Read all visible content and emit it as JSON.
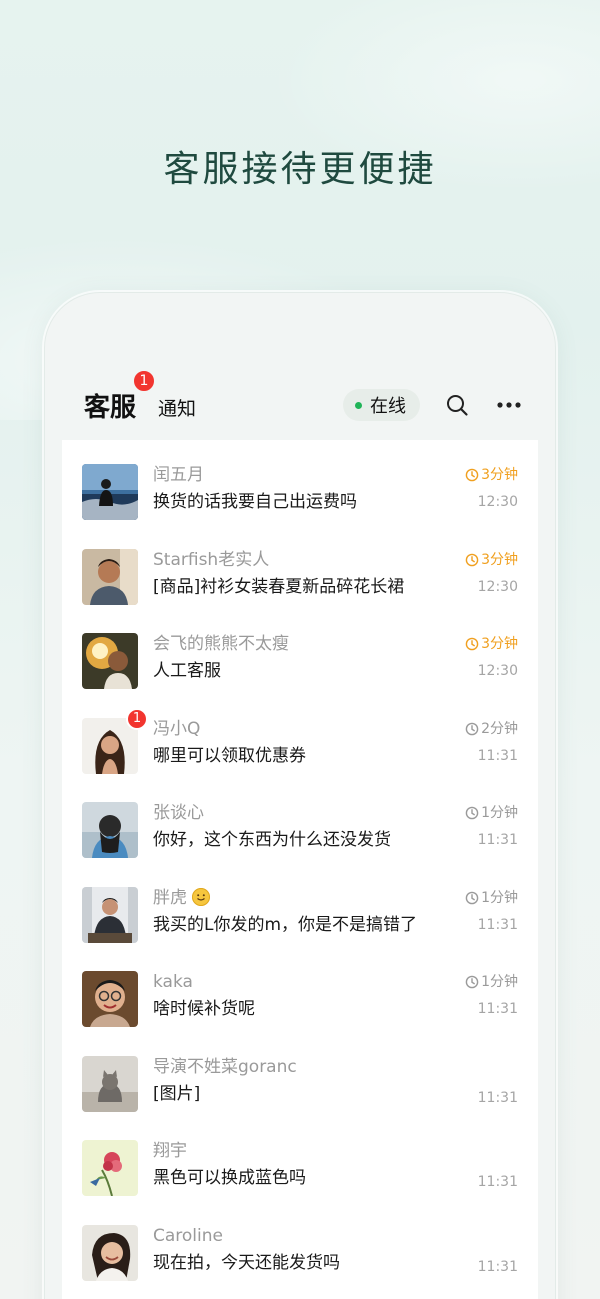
{
  "headline": "客服接待更便捷",
  "header": {
    "tab_service": "客服",
    "tab_service_badge": "1",
    "tab_notice": "通知",
    "status": "在线",
    "status_color": "#20b458"
  },
  "colors": {
    "warn": "#f0a020",
    "badge": "#f2352f"
  },
  "conversations": [
    {
      "name": "闰五月",
      "message": "换货的话我要自己出运费吗",
      "wait": "3分钟",
      "wait_level": "warn",
      "time": "12:30",
      "avatar": "seaside-person"
    },
    {
      "name": "Starfish老实人",
      "message": "[商品]衬衫女装春夏新品碎花长裙",
      "wait": "3分钟",
      "wait_level": "warn",
      "time": "12:30",
      "avatar": "smiling-man"
    },
    {
      "name": "会飞的熊熊不太瘦",
      "message": "人工客服",
      "wait": "3分钟",
      "wait_level": "warn",
      "time": "12:30",
      "avatar": "sunset-portrait"
    },
    {
      "name": "冯小Q",
      "message": "哪里可以领取优惠券",
      "wait": "2分钟",
      "wait_level": "normal",
      "time": "11:31",
      "avatar": "long-hair-woman",
      "badge": "1"
    },
    {
      "name": "张谈心",
      "message": "你好，这个东西为什么还没发货",
      "wait": "1分钟",
      "wait_level": "normal",
      "time": "11:31",
      "avatar": "back-view-woman"
    },
    {
      "name": "胖虎",
      "message": "我买的L你发的m，你是不是搞错了",
      "wait": "1分钟",
      "wait_level": "normal",
      "time": "11:31",
      "avatar": "man-at-desk",
      "name_emoji": "smile-emoji"
    },
    {
      "name": "kaka",
      "message": "啥时候补货呢",
      "wait": "1分钟",
      "wait_level": "normal",
      "time": "11:31",
      "avatar": "glasses-man"
    },
    {
      "name": "导演不姓菜goranc",
      "message": "[图片]",
      "wait": "",
      "wait_level": "none",
      "time": "11:31",
      "avatar": "cat"
    },
    {
      "name": "翔宇",
      "message": "黑色可以换成蓝色吗",
      "wait": "",
      "wait_level": "none",
      "time": "11:31",
      "avatar": "flower-painting"
    },
    {
      "name": "Caroline",
      "message": "现在拍，今天还能发货吗",
      "wait": "",
      "wait_level": "none",
      "time": "11:31",
      "avatar": "smiling-woman"
    }
  ]
}
